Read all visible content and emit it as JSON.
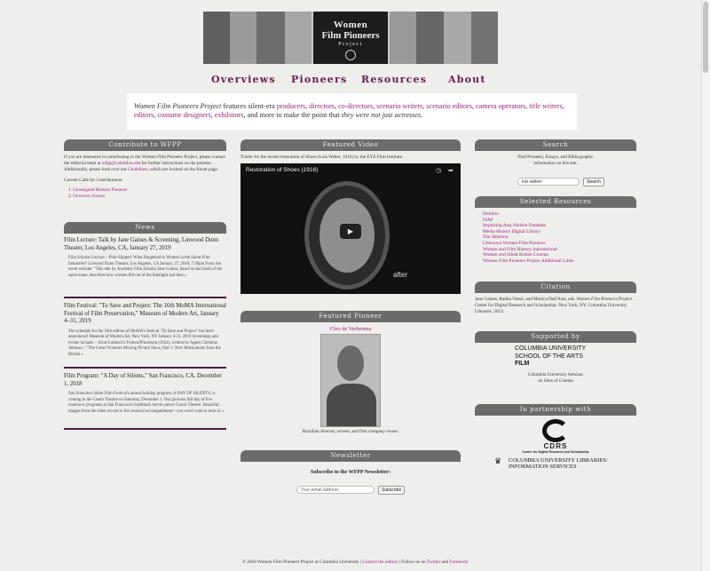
{
  "banner": {
    "line1": "Women",
    "line2": "Film Pioneers",
    "line3": "Project"
  },
  "nav": [
    "Overviews",
    "Pioneers",
    "Resources",
    "About"
  ],
  "intro": {
    "lead": "Women Film Pioneers Project",
    "t1": " features silent-era ",
    "roles": [
      "producers",
      "directors",
      "co-directors",
      "scenario writers",
      "scenario editors",
      "camera operators",
      "title writers",
      "editors",
      "costume designers",
      "exhibitors"
    ],
    "t2": ", and more to make the point that ",
    "emph": "they were not just actresses",
    "t3": "."
  },
  "contribute": {
    "heading": "Contribute to WFPP",
    "p1a": "If you are interested in contributing to the Women Film Pioneers Project, please contact the editorial team at ",
    "email": "wfpp@columbia.edu",
    "p1b": " for further instructions on the process. Additionally, please look over our ",
    "guidelines": "Guidelines",
    "p1c": ", which are located on the About page.",
    "calls_label": "Current Calls for Contributions:",
    "calls": [
      "Unassigned Russian Pioneers",
      "Overview Essays"
    ]
  },
  "news": {
    "heading": "News",
    "items": [
      {
        "title": "Film Lecture: Talk by Jane Gaines & Screening, Linwood Dunn Theater, Los Angeles, CA, January 27, 2019",
        "body": "Film Scholar Lecture – Pink-Slipped: What Happened to Women in the Silent Film Industries? Linwood Dunn Theater, Los Angeles, CA January 27, 2018, 7:30pm From the event website: \"This talk by Academy Film Scholar Jane Gaines, based on her book of the same name, describes how women fell out of the limelight and then »"
      },
      {
        "title": "Film Festival: \"To Save and Project: The 16th MoMA International Festival of Film Preservation,\" Museum of Modern Art, January 4–31, 2019",
        "body": "The schedule for the 16th edition of MoMA's festival \"To Save and Project\" has been announced! Museum of Modern Art, New York, NY January 4-31, 2019 Screenings and events include: – Ernst Lubitsch's Fedora/Prinzessin (1924), written by Agnes Christine Johnson – \"The Great Victorian Moving Picture Show, Part 1: New Restorations from the British »"
      },
      {
        "title": "Film Program: \"A Day of Silents,\" San Francisco, CA, December 1, 2018",
        "body": "San Francisco Silent Film Festival's annual holiday program, A DAY OF SILENTS, is coming to the Castro Theatre on Saturday, December 1. Our glorious full day of five cinema-ic programs at San Francisco's landmark movie palace Castro Theatre. Beautiful images from the silent era set to live musical accompaniment—you won't want to miss it! »"
      }
    ]
  },
  "video": {
    "heading": "Featured Video",
    "caption": "Trailer for the recent restoration of Shoes (Lois Weber, 1916) by the EYE Film Institute.",
    "title": "Restoration of Shoes (1916)",
    "overlay": "after"
  },
  "pioneer": {
    "heading": "Featured Pioneer",
    "name": "Cleo de Verberena",
    "caption": "Brazilian director, actress, and film company owner."
  },
  "newsletter": {
    "heading": "Newsletter",
    "label": "Subscribe to the WFPP Newsletter:",
    "placeholder": "Your email address",
    "button": "Subscribe"
  },
  "search": {
    "heading": "Search",
    "text": "Find Pioneers, Essays, and Bibliographic information on this site.",
    "value": "lois weber",
    "button": "Search"
  },
  "resources": {
    "heading": "Selected Resources",
    "links": [
      "Domitor",
      "FIAF",
      "Importing Asta Nielsen Database",
      "Media History Digital Library",
      "The Skeleton",
      "Unknown Women Film Pioneers",
      "Women and Film History International",
      "Women and Silent British Cinema",
      "Women Film Pioneers Project Additional Links"
    ]
  },
  "citation": {
    "heading": "Citation",
    "a": "Jane Gaines, Radha Vatsal, and Monica Dall'Asta, eds. ",
    "title": "Women Film Pioneers Project",
    "b": ". Center for Digital Research and Scholarship. New York, NY: Columbia University Libraries, 2013."
  },
  "supported": {
    "heading": "Supported by",
    "line1": "COLUMBIA UNIVERSITY",
    "line2": "SCHOOL OF THE ARTS",
    "line3": "FILM",
    "seminar1": "Columbia University Seminar",
    "seminar2": "on Sites of Cinema"
  },
  "partnership": {
    "heading": "In partnership with",
    "cdrs": "CDRS",
    "cdrs_sub": "Center for Digital Research and Scholarship",
    "libs1": "COLUMBIA UNIVERSITY LIBRARIES/",
    "libs2": "INFORMATION SERVICES"
  },
  "footer": {
    "a": "© 2018 Women Film Pioneers Project at Columbia University | ",
    "contact": "Contact the editors",
    "b": " | Follow us on ",
    "twitter": "Twitter",
    "c": " and ",
    "facebook": "Facebook"
  },
  "colors": {
    "accent": "#a0207a",
    "nav": "#6a1b4d",
    "header": "#6b6b6b",
    "divider": "#4a1b3e"
  }
}
